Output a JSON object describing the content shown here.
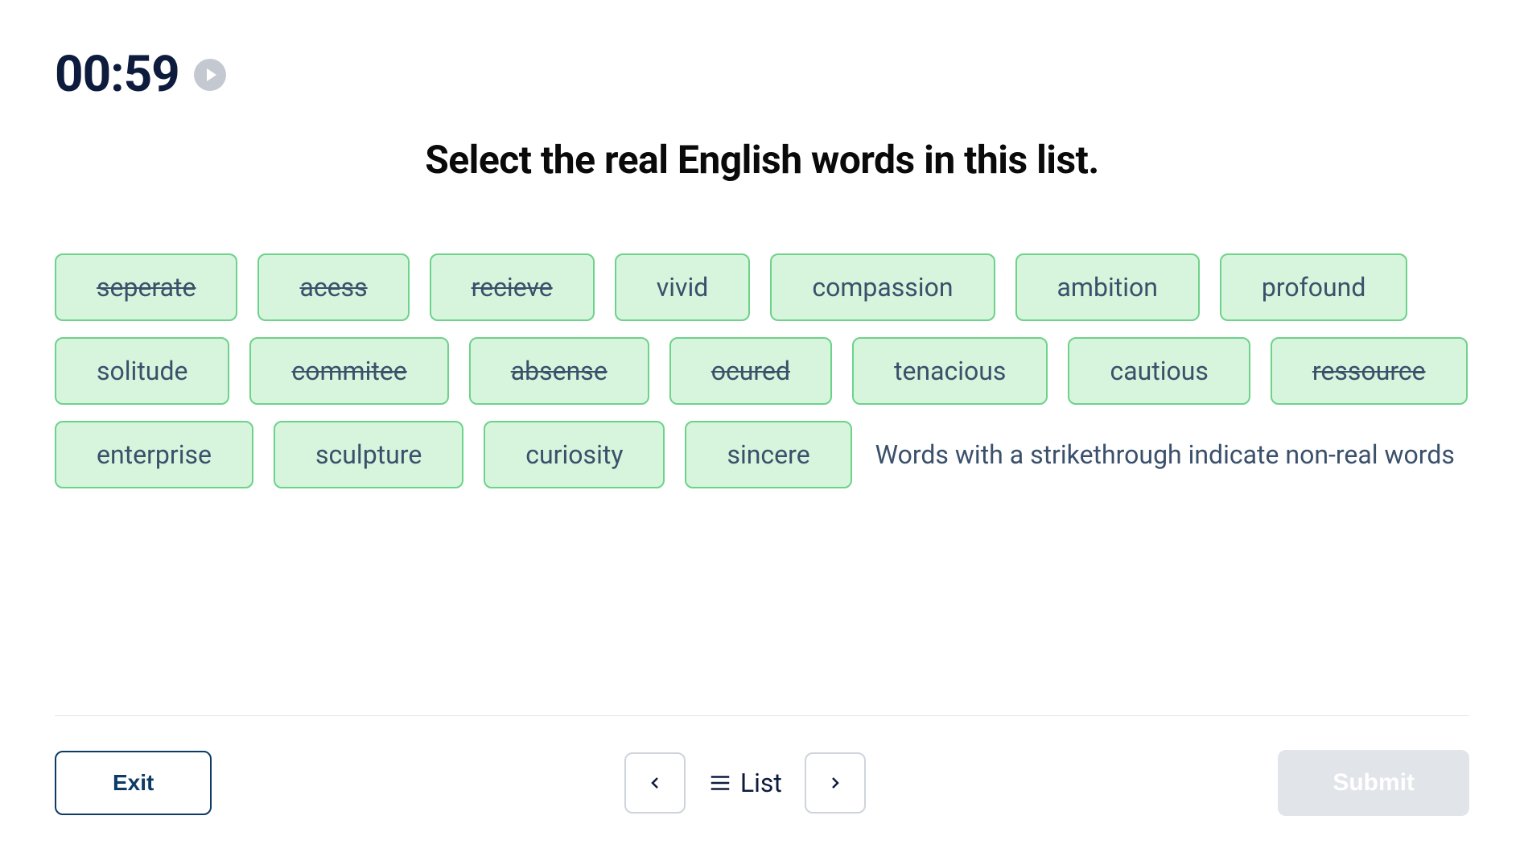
{
  "timer": "00:59",
  "instruction": "Select the real English words in this list.",
  "words": [
    {
      "text": "seperate",
      "struck": true
    },
    {
      "text": "acess",
      "struck": true
    },
    {
      "text": "recieve",
      "struck": true
    },
    {
      "text": "vivid",
      "struck": false
    },
    {
      "text": "compassion",
      "struck": false
    },
    {
      "text": "ambition",
      "struck": false
    },
    {
      "text": "profound",
      "struck": false
    },
    {
      "text": "solitude",
      "struck": false
    },
    {
      "text": "commitee",
      "struck": true
    },
    {
      "text": "absense",
      "struck": true
    },
    {
      "text": "ocured",
      "struck": true
    },
    {
      "text": "tenacious",
      "struck": false
    },
    {
      "text": "cautious",
      "struck": false
    },
    {
      "text": "ressource",
      "struck": true
    },
    {
      "text": "enterprise",
      "struck": false
    },
    {
      "text": "sculpture",
      "struck": false
    },
    {
      "text": "curiosity",
      "struck": false
    },
    {
      "text": "sincere",
      "struck": false
    }
  ],
  "hint": "Words with a strikethrough indicate non-real words",
  "footer": {
    "exit": "Exit",
    "list": "List",
    "submit": "Submit"
  }
}
